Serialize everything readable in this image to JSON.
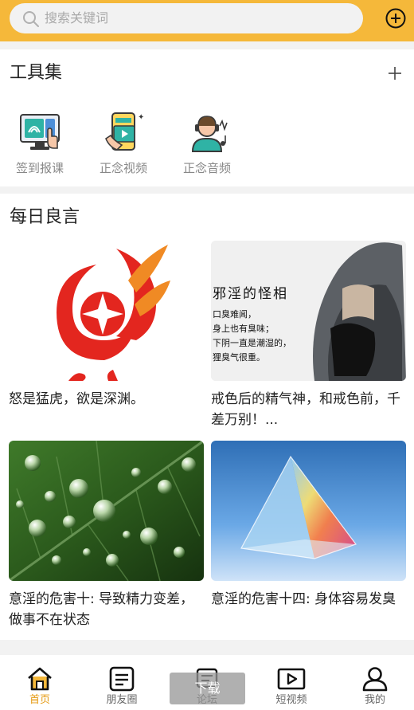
{
  "search": {
    "placeholder": "搜索关键词",
    "icon": "search-icon"
  },
  "header": {
    "add_icon": "add-circle-icon",
    "accent": "#f5b83a"
  },
  "tools": {
    "title": "工具集",
    "add_icon": "plus-icon",
    "items": [
      {
        "label": "签到报课",
        "icon": "fingerprint-checkin-icon"
      },
      {
        "label": "正念视频",
        "icon": "video-phone-icon"
      },
      {
        "label": "正念音频",
        "icon": "headset-audio-icon"
      }
    ]
  },
  "quotes": {
    "title": "每日良言",
    "cards": [
      {
        "text": "怒是猛虎，欲是深渊。",
        "image": "red-flame-star-logo"
      },
      {
        "text": "戒色后的精气神，和戒色前，千差万别！...",
        "image": "hooded-figure-with-calligraphy",
        "image_text": [
          "邪淫的怪相",
          "口臭难闻，",
          "身上也有臭味；",
          "下阴一直是潮湿的，",
          "狸臭气很重。"
        ]
      },
      {
        "text": "意淫的危害十: 导致精力变差，做事不在状态",
        "image": "water-drops-on-leaf"
      },
      {
        "text": "意淫的危害十四: 身体容易发臭",
        "image": "glass-prism-pyramid"
      }
    ]
  },
  "tabbar": {
    "items": [
      {
        "label": "首页",
        "icon": "home-icon",
        "active": true
      },
      {
        "label": "朋友圈",
        "icon": "moments-icon",
        "active": false
      },
      {
        "label": "论坛",
        "icon": "forum-icon",
        "active": false
      },
      {
        "label": "短视频",
        "icon": "short-video-icon",
        "active": false
      },
      {
        "label": "我的",
        "icon": "profile-icon",
        "active": false
      }
    ],
    "active_color": "#e59a12",
    "overlay_button": "下载"
  }
}
